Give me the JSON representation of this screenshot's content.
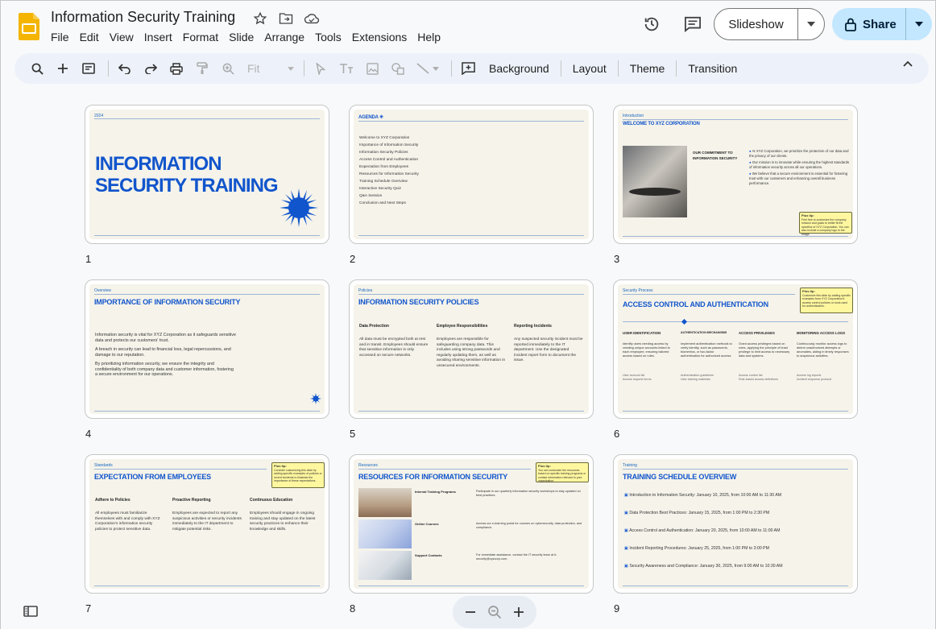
{
  "app": {
    "title": "Information Security Training",
    "menu": [
      "File",
      "Edit",
      "View",
      "Insert",
      "Format",
      "Slide",
      "Arrange",
      "Tools",
      "Extensions",
      "Help"
    ],
    "slideshow_label": "Slideshow",
    "share_label": "Share"
  },
  "toolbar": {
    "fit_label": "Fit",
    "background": "Background",
    "layout": "Layout",
    "theme": "Theme",
    "transition": "Transition"
  },
  "colors": {
    "accent": "#1155cc",
    "share_bg": "#c2e7ff",
    "slide_bg": "#f5f3ea",
    "tip_bg": "#fff79f"
  },
  "slides": {
    "s1": {
      "num": "1",
      "tag": "2024",
      "title1": "INFORMATION",
      "title2": "SECURITY TRAINING"
    },
    "s2": {
      "num": "2",
      "title": "AGENDA ✳",
      "items": [
        "Welcome to XYZ Corporation",
        "Importance of Information Security",
        "Information Security Policies",
        "Access Control and Authentication",
        "Expectation from Employees",
        "Resources for Information Security",
        "Training Schedule Overview",
        "Interactive Security Quiz",
        "Q&A Session",
        "Conclusion and Next Steps"
      ]
    },
    "s3": {
      "num": "3",
      "tag": "Introduction",
      "title": "WELCOME TO XYZ CORPORATION",
      "sub1": "OUR COMMITMENT TO",
      "sub2": "INFORMATION SECURITY",
      "bullets": [
        "At XYZ Corporation, we prioritize the protection of our data and the privacy of our clients.",
        "Our mission is to innovate while ensuring the highest standards of information security across all our operations.",
        "We believe that a secure environment is essential for fostering trust with our customers and enhancing overall business performance."
      ],
      "tip_title": "Plus tip:",
      "tip_text": "Feel free to customize the company mission and goals to better fit the specifics of XYZ Corporation. You can also include a company logo in the image."
    },
    "s4": {
      "num": "4",
      "tag": "Overview",
      "title": "IMPORTANCE OF INFORMATION SECURITY",
      "paras": [
        "Information security is vital for XYZ Corporation as it safeguards sensitive data and protects our customers' trust.",
        "A breach in security can lead to financial loss, legal repercussions, and damage to our reputation.",
        "By prioritizing information security, we ensure the integrity and confidentiality of both company data and customer information, fostering a secure environment for our operations."
      ]
    },
    "s5": {
      "num": "5",
      "tag": "Policies",
      "title": "INFORMATION SECURITY POLICIES",
      "cols": [
        {
          "h": "Data Protection",
          "t": "All data must be encrypted both at rest and in transit. Employees should ensure that sensitive information is only accessed on secure networks."
        },
        {
          "h": "Employee Responsibilities",
          "t": "Employees are responsible for safeguarding company data. This includes using strong passwords and regularly updating them, as well as avoiding sharing sensitive information in unsecured environments."
        },
        {
          "h": "Reporting Incidents",
          "t": "Any suspected security incident must be reported immediately to the IT department. Use the designated incident report form to document the issue."
        }
      ]
    },
    "s6": {
      "num": "6",
      "tag": "Security Process",
      "title": "ACCESS CONTROL AND AUTHENTICATION",
      "tip_title": "Plus tip:",
      "tip_text": "Customize this slide by adding specific examples from XYZ Corporation's access control policies or tools used for authentication.",
      "cols": [
        {
          "h": "USER IDENTIFICATION",
          "t": "Identify users needing access by creating unique accounts linked to each employee, ensuring tailored access based on roles.",
          "l": "User account list\nAccess request forms"
        },
        {
          "h": "AUTHENTICATION MECHANISMS",
          "t": "Implement authentication methods to verify identity, such as passwords, biometrics, or two-factor authentication for authorized access.",
          "l": "Authentication guidelines\nUser training materials"
        },
        {
          "h": "ACCESS PRIVILEGES",
          "t": "Grant access privileges based on roles, applying the principle of least privilege to limit access to necessary data and systems.",
          "l": "Access control list\nRole-based access definitions"
        },
        {
          "h": "MONITORING ACCESS LOGS",
          "t": "Continuously monitor access logs to detect unauthorized attempts or anomalies, aiding in timely responses to suspicious activities.",
          "l": "Access log reports\nIncident response protocol"
        }
      ]
    },
    "s7": {
      "num": "7",
      "tag": "Standards",
      "title": "EXPECTATION FROM EMPLOYEES",
      "tip_title": "Plus tip:",
      "tip_text": "Consider customizing this slide by adding specific examples of policies or recent incidents to illustrate the importance of these expectations.",
      "cols": [
        {
          "h": "Adhere to Policies",
          "t": "All employees must familiarize themselves with and comply with XYZ Corporation's information security policies to protect sensitive data."
        },
        {
          "h": "Proactive Reporting",
          "t": "Employees are expected to report any suspicious activities or security incidents immediately to the IT department to mitigate potential risks."
        },
        {
          "h": "Continuous Education",
          "t": "Employees should engage in ongoing training and stay updated on the latest security practices to enhance their knowledge and skills."
        }
      ]
    },
    "s8": {
      "num": "8",
      "tag": "Resources",
      "title": "RESOURCES FOR INFORMATION SECURITY",
      "tip_title": "Plus tip:",
      "tip_text": "You can customize the resources based on specific training programs or contact information relevant to your organization.",
      "rows": [
        {
          "h": "Internal Training Programs",
          "t": "Participate in our quarterly information security workshops to stay updated on best practices."
        },
        {
          "h": "Online Courses",
          "t": "Access our e-learning portal for courses on cybersecurity, data protection, and compliance."
        },
        {
          "h": "Support Contacts",
          "t": "For immediate assistance, contact the IT security team at it-security@xyzcorp.com."
        }
      ]
    },
    "s9": {
      "num": "9",
      "tag": "Training",
      "title": "TRAINING SCHEDULE OVERVIEW",
      "items": [
        "Introduction to Information Security: January 10, 2025, from 10:00 AM to 11:30 AM",
        "Data Protection Best Practices: January 15, 2025, from 1:00 PM to 2:30 PM",
        "Access Control and Authentication: January 20, 2025, from 10:00 AM to 11:00 AM",
        "Incident Reporting Procedures: January 25, 2025, from 1:00 PM to 3:00 PM",
        "Security Awareness and Compliance: January 30, 2025, from 9:00 AM to 10:30 AM"
      ]
    }
  }
}
